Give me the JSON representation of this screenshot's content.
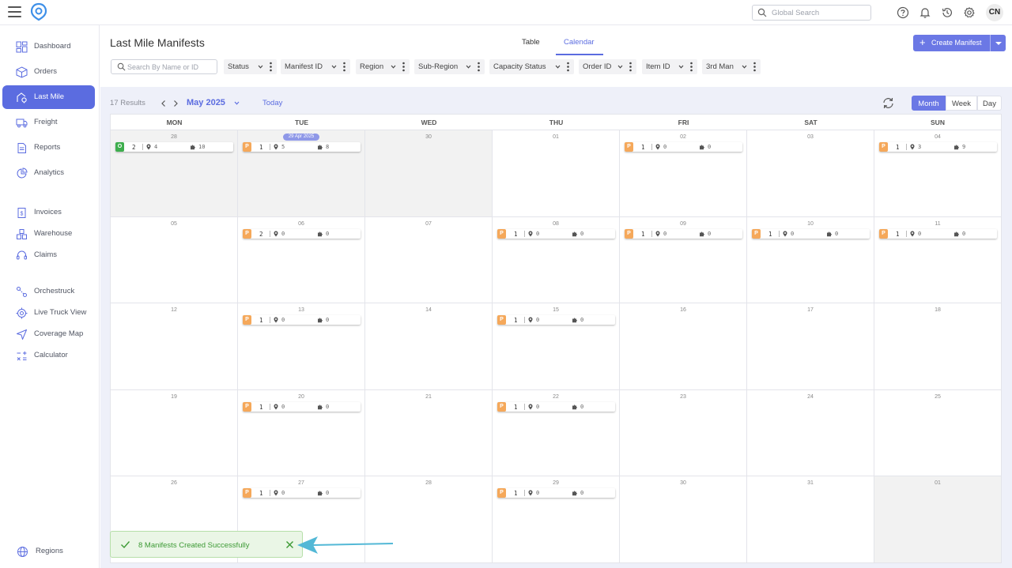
{
  "topbar": {
    "search_placeholder": "Global Search",
    "avatar_initials": "CN",
    "icons": [
      "help-icon",
      "bell-icon",
      "history-icon",
      "gear-icon"
    ]
  },
  "sidebar": {
    "items": [
      {
        "label": "Dashboard",
        "icon": "dashboard-icon"
      },
      {
        "label": "Orders",
        "icon": "box-icon"
      },
      {
        "label": "Last Mile",
        "icon": "last-mile-icon"
      },
      {
        "label": "Freight",
        "icon": "truck-icon"
      },
      {
        "label": "Reports",
        "icon": "reports-icon"
      },
      {
        "label": "Analytics",
        "icon": "analytics-icon"
      },
      {
        "label": "Invoices",
        "icon": "invoice-icon"
      },
      {
        "label": "Warehouse",
        "icon": "warehouse-icon"
      },
      {
        "label": "Claims",
        "icon": "headset-icon"
      },
      {
        "label": "Orchestruck",
        "icon": "orchestruck-icon"
      },
      {
        "label": "Live Truck View",
        "icon": "target-icon"
      },
      {
        "label": "Coverage Map",
        "icon": "navigation-icon"
      },
      {
        "label": "Calculator",
        "icon": "calculator-icon"
      }
    ],
    "active": "Last Mile",
    "footer": {
      "label": "Regions",
      "icon": "globe-icon"
    }
  },
  "header": {
    "title": "Last Mile Manifests",
    "tabs": [
      "Table",
      "Calendar"
    ],
    "active_tab": "Calendar",
    "create_button": "Create Manifest"
  },
  "filters": {
    "search_placeholder": "Search By Name or ID",
    "items": [
      "Status",
      "Manifest ID",
      "Region",
      "Sub-Region",
      "Capacity Status",
      "Order ID",
      "Item ID",
      "3rd Man"
    ]
  },
  "calendar": {
    "results": "17 Results",
    "month": "May 2025",
    "today_label": "Today",
    "views": [
      "Month",
      "Week",
      "Day"
    ],
    "active_view": "Month",
    "days_of_week": [
      "MON",
      "TUE",
      "WED",
      "THU",
      "FRI",
      "SAT",
      "SUN"
    ],
    "today_pill": "29 Apr 2025",
    "colors": {
      "P": "#f5a85a",
      "O": "#3eae4d",
      "accent": "#5b6ce0"
    },
    "weeks": [
      [
        {
          "day": "28",
          "muted": true,
          "manifest": {
            "badge": "O",
            "count": "2",
            "stops": "4",
            "items": "10"
          }
        },
        {
          "day": "29",
          "muted": true,
          "today": true,
          "manifest": {
            "badge": "P",
            "count": "1",
            "stops": "5",
            "items": "8"
          }
        },
        {
          "day": "30",
          "muted": true
        },
        {
          "day": "01"
        },
        {
          "day": "02",
          "manifest": {
            "badge": "P",
            "count": "1",
            "stops": "0",
            "items": "0"
          }
        },
        {
          "day": "03"
        },
        {
          "day": "04",
          "manifest": {
            "badge": "P",
            "count": "1",
            "stops": "3",
            "items": "9"
          }
        }
      ],
      [
        {
          "day": "05"
        },
        {
          "day": "06",
          "manifest": {
            "badge": "P",
            "count": "2",
            "stops": "0",
            "items": "0"
          }
        },
        {
          "day": "07"
        },
        {
          "day": "08",
          "manifest": {
            "badge": "P",
            "count": "1",
            "stops": "0",
            "items": "0"
          }
        },
        {
          "day": "09",
          "manifest": {
            "badge": "P",
            "count": "1",
            "stops": "0",
            "items": "0"
          }
        },
        {
          "day": "10",
          "manifest": {
            "badge": "P",
            "count": "1",
            "stops": "0",
            "items": "0"
          }
        },
        {
          "day": "11",
          "manifest": {
            "badge": "P",
            "count": "1",
            "stops": "0",
            "items": "0"
          }
        }
      ],
      [
        {
          "day": "12"
        },
        {
          "day": "13",
          "manifest": {
            "badge": "P",
            "count": "1",
            "stops": "0",
            "items": "0"
          }
        },
        {
          "day": "14"
        },
        {
          "day": "15",
          "manifest": {
            "badge": "P",
            "count": "1",
            "stops": "0",
            "items": "0"
          }
        },
        {
          "day": "16"
        },
        {
          "day": "17"
        },
        {
          "day": "18"
        }
      ],
      [
        {
          "day": "19"
        },
        {
          "day": "20",
          "manifest": {
            "badge": "P",
            "count": "1",
            "stops": "0",
            "items": "0"
          }
        },
        {
          "day": "21"
        },
        {
          "day": "22",
          "manifest": {
            "badge": "P",
            "count": "1",
            "stops": "0",
            "items": "0"
          }
        },
        {
          "day": "23"
        },
        {
          "day": "24"
        },
        {
          "day": "25"
        }
      ],
      [
        {
          "day": "26"
        },
        {
          "day": "27",
          "manifest": {
            "badge": "P",
            "count": "1",
            "stops": "0",
            "items": "0"
          }
        },
        {
          "day": "28"
        },
        {
          "day": "29",
          "manifest": {
            "badge": "P",
            "count": "1",
            "stops": "0",
            "items": "0"
          }
        },
        {
          "day": "30"
        },
        {
          "day": "31"
        },
        {
          "day": "01",
          "muted": true
        }
      ]
    ]
  },
  "toast": {
    "message": "8 Manifests Created Successfully"
  }
}
